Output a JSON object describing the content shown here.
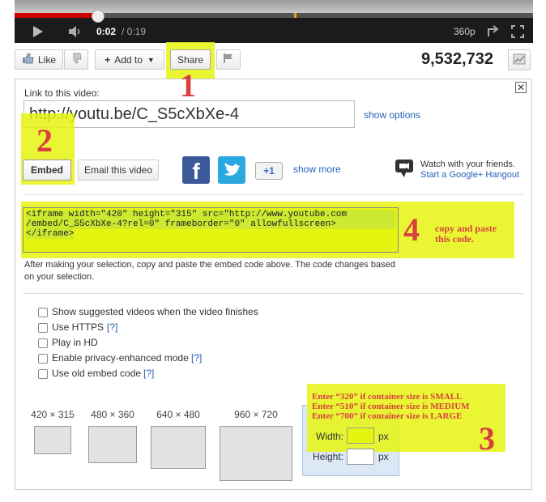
{
  "player": {
    "time_current": "0:02",
    "time_total": "/ 0:19",
    "quality": "360p",
    "progress_fraction": 0.16
  },
  "toolbar": {
    "like_label": "Like",
    "add_to_label": "Add to",
    "share_label": "Share",
    "view_count": "9,532,732"
  },
  "share": {
    "link_label": "Link to this video:",
    "link_value": "http://youtu.be/C_S5cXbXe-4",
    "show_options": "show options",
    "embed_button": "Embed",
    "email_button": "Email this video",
    "gplus_label": "+1",
    "show_more": "show more",
    "hangout_title": "Watch with your friends.",
    "hangout_link": "Start a Google+ Hangout"
  },
  "embed": {
    "code_line1": "<iframe width=\"420\" height=\"315\" src=\"http://www.youtube.com",
    "code_line2": "/embed/C_S5cXbXe-4?rel=0\" frameborder=\"0\" allowfullscreen>",
    "code_line3": "</iframe>",
    "help_line1": "After making your selection, copy and paste the embed code above. The code changes based",
    "help_line2": "on your selection."
  },
  "options": [
    {
      "label": "Show suggested videos when the video finishes",
      "help": ""
    },
    {
      "label": "Use HTTPS",
      "help": "[?]"
    },
    {
      "label": "Play in HD",
      "help": ""
    },
    {
      "label": "Enable privacy-enhanced mode",
      "help": "[?]"
    },
    {
      "label": "Use old embed code",
      "help": "[?]"
    }
  ],
  "sizes": [
    "420 × 315",
    "480 × 360",
    "640 × 480",
    "960 × 720"
  ],
  "custom_size": {
    "width_label": "Width:",
    "height_label": "Height:",
    "unit": "px"
  },
  "annotations": {
    "n1": "1",
    "n2": "2",
    "n3": "3",
    "n4": "4",
    "copy_line1": "copy and paste",
    "copy_line2": "this code.",
    "size_line1": "Enter “320” if container size is SMALL",
    "size_line2": "Enter “510” if container size is MEDIUM",
    "size_line3": "Enter “700” if container size is LARGE"
  },
  "colors": {
    "highlight": "#e6f50f",
    "annotation": "#d9403f",
    "link": "#2561b5",
    "progress": "#cc0000"
  }
}
